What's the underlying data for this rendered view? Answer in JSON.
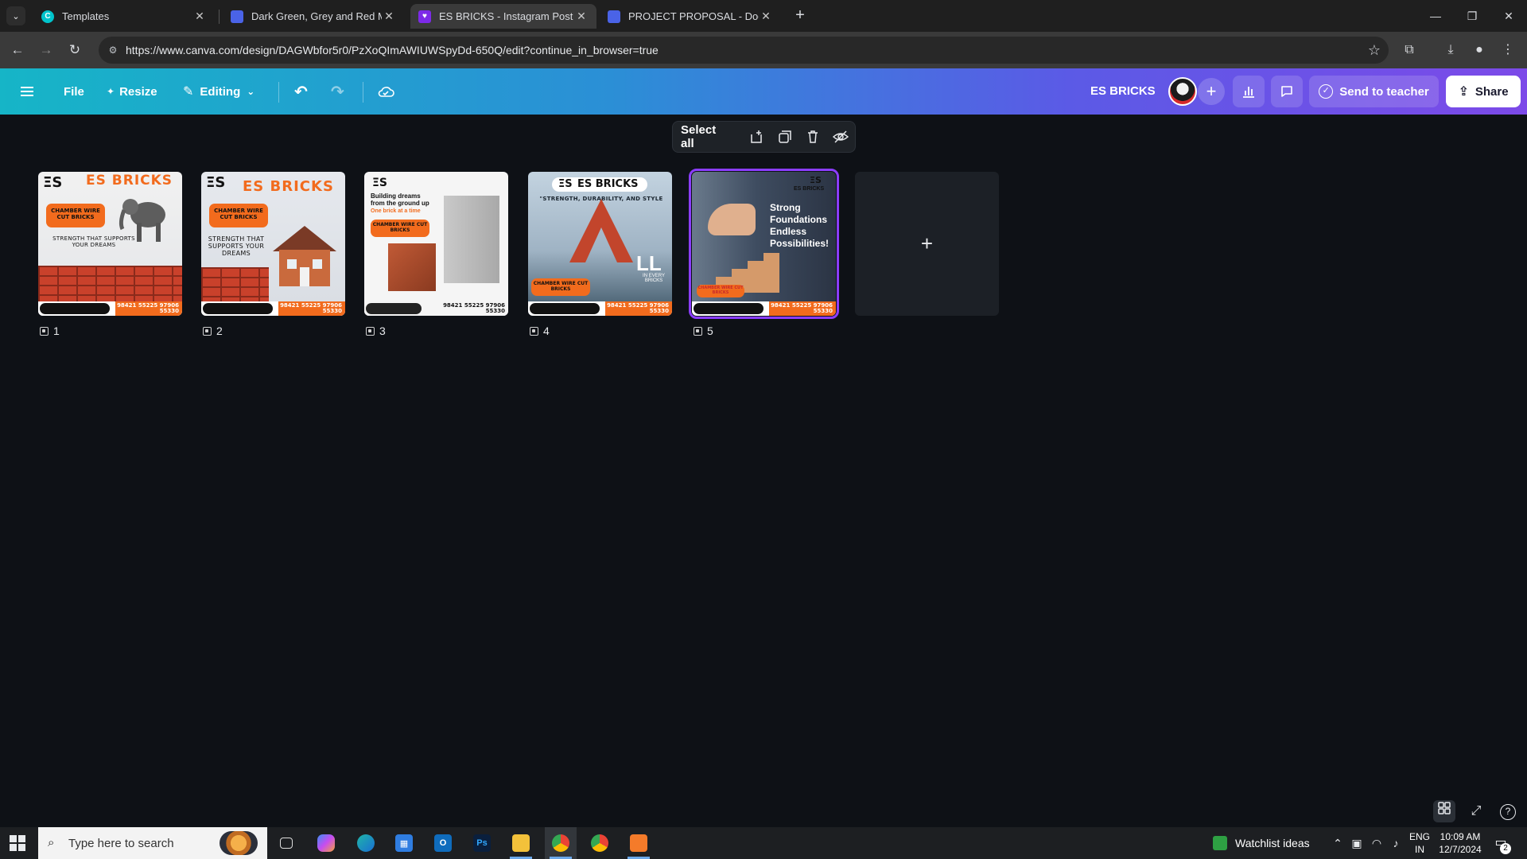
{
  "browser": {
    "tabs": [
      {
        "title": "Templates",
        "favicon_color": "#00c4cc"
      },
      {
        "title": "Dark Green, Grey and Red Mod",
        "favicon_color": "#4a63e7"
      },
      {
        "title": "ES BRICKS - Instagram Post - C",
        "favicon_color": "#7d2ae8"
      },
      {
        "title": "PROJECT PROPOSAL - Doc",
        "favicon_color": "#4a63e7"
      }
    ],
    "new_tab_label": "+",
    "close_glyph": "✕",
    "url": "https://www.canva.com/design/DAGWbfor5r0/PzXoQImAWIUWSpyDd-650Q/edit?continue_in_browser=true"
  },
  "canva": {
    "menu": {
      "file": "File",
      "resize": "Resize",
      "editing": "Editing"
    },
    "doc_name": "ES BRICKS",
    "send_to_teacher": "Send to teacher",
    "share": "Share",
    "selection_toolbar": {
      "select_all": "Select all"
    },
    "pages": [
      {
        "number": "1",
        "brand": "ES BRICKS",
        "pill": "CHAMBER WIRE CUT BRICKS",
        "tagline": "STRENGTH THAT SUPPORTS YOUR DREAMS",
        "phone": "98421 55225 97906 55330"
      },
      {
        "number": "2",
        "brand": "ES BRICKS",
        "pill": "CHAMBER WIRE CUT BRICKS",
        "tagline": "STRENGTH THAT SUPPORTS YOUR DREAMS",
        "phone": "98421 55225 97906 55330"
      },
      {
        "number": "3",
        "headline": "Building dreams from the ground up",
        "sub": "One brick at a time",
        "pill": "CHAMBER WIRE CUT BRICKS",
        "phone": "98421 55225 97906 55330"
      },
      {
        "number": "4",
        "brand": "ES BRICKS",
        "tagline": "\"STRENGTH, DURABILITY, AND STYLE",
        "big": "LL",
        "side": "IN EVERY BRICKS",
        "pill": "CHAMBER WIRE CUT BRICKS",
        "phone": "98421 55225 97906 55330"
      },
      {
        "number": "5",
        "brand": "ES BRICKS",
        "headline": "Strong Foundations Endless Possibilities!",
        "pill": "CHAMBER WIRE CUT BRICKS",
        "phone": "98421 55225 97906 55330"
      }
    ],
    "add_page": "+"
  },
  "taskbar": {
    "search_placeholder": "Type here to search",
    "watchlist": "Watchlist ideas",
    "lang_line1": "ENG",
    "lang_line2": "IN",
    "time": "10:09 AM",
    "date": "12/7/2024",
    "notifications": "2"
  },
  "colors": {
    "accent_purple": "#8b3dff",
    "brick_orange": "#f26b1d",
    "brick_red": "#c9412b"
  }
}
